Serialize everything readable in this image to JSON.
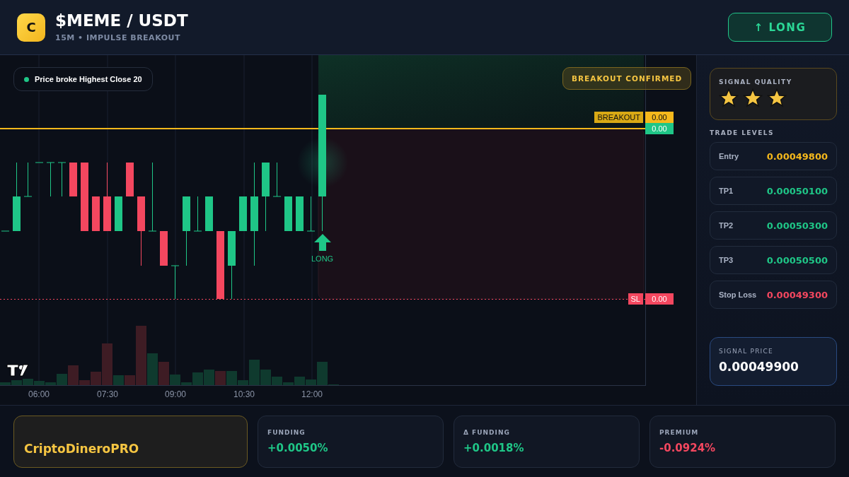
{
  "header": {
    "coin_initial": "C",
    "pair": "$MEME / USDT",
    "subtitle": "15M • IMPULSE BREAKOUT",
    "action_button": "↑ LONG"
  },
  "chart": {
    "note": "Price broke Highest Close 20",
    "badge": "BREAKOUT CONFIRMED",
    "price_tags": [
      {
        "kind": "breakout",
        "label": "BREAKOUT",
        "value": "0.00"
      },
      {
        "kind": "current",
        "value": "0.00"
      },
      {
        "kind": "stop",
        "label": "SL",
        "value": "0.00"
      }
    ],
    "signal_marker": "LONG",
    "time_labels": [
      "06:00",
      "07:30",
      "09:00",
      "10:30",
      "12:00"
    ]
  },
  "signal_quality": {
    "title": "SIGNAL QUALITY",
    "stars": 3
  },
  "trade_levels": {
    "title": "TRADE LEVELS",
    "items": [
      {
        "label": "Entry",
        "value": "0.00049800",
        "kind": "entry"
      },
      {
        "label": "TP1",
        "value": "0.00050100",
        "kind": "target"
      },
      {
        "label": "TP2",
        "value": "0.00050300",
        "kind": "target"
      },
      {
        "label": "TP3",
        "value": "0.00050500",
        "kind": "target"
      },
      {
        "label": "Stop Loss",
        "value": "0.00049300",
        "kind": "stop"
      }
    ]
  },
  "signal_price": {
    "label": "SIGNAL PRICE",
    "value": "0.00049900"
  },
  "footer": {
    "brand": "CriptoDineroPRO",
    "metrics": [
      {
        "label": "FUNDING",
        "value": "+0.0050%",
        "kind": "positive"
      },
      {
        "label": "Δ FUNDING",
        "value": "+0.0018%",
        "kind": "positive"
      },
      {
        "label": "PREMIUM",
        "value": "-0.0924%",
        "kind": "negative"
      }
    ]
  }
}
